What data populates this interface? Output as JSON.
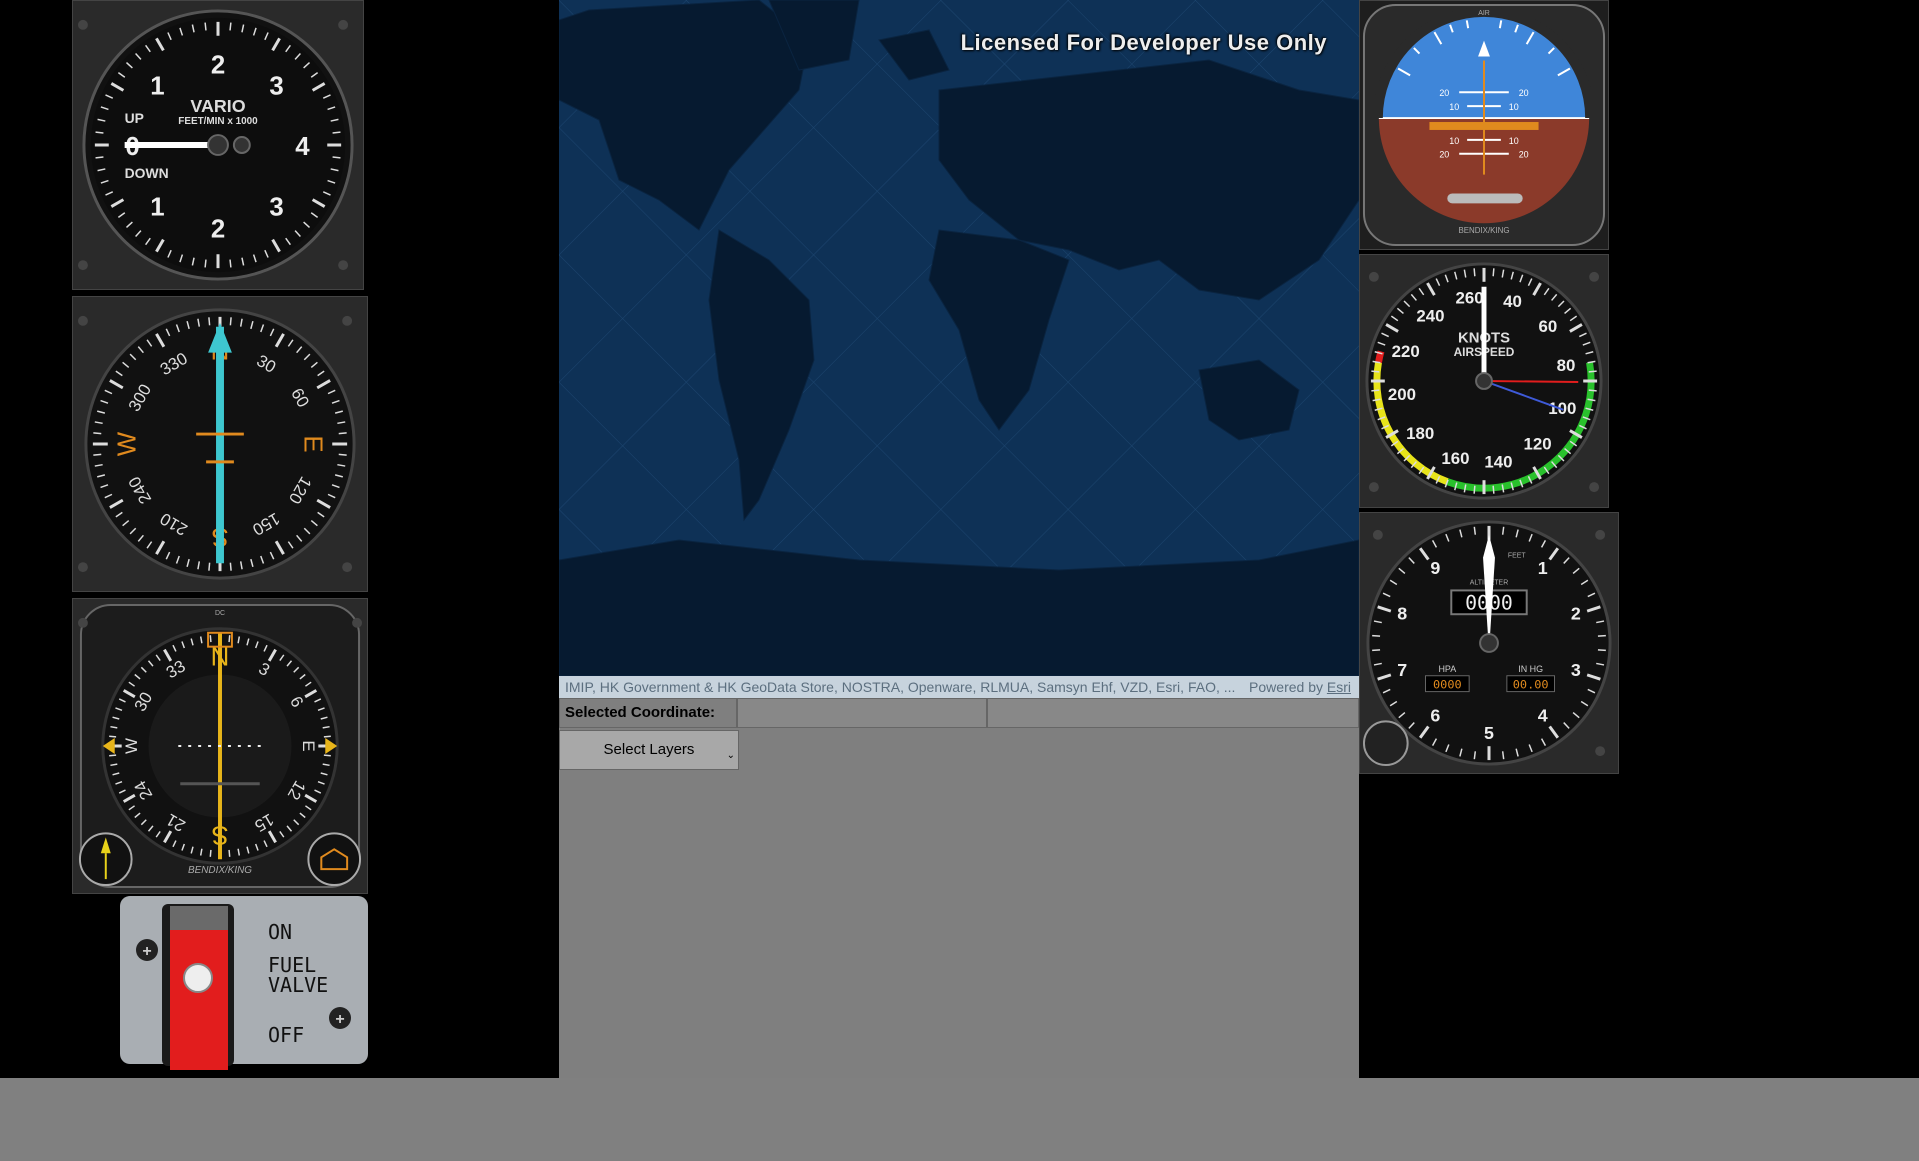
{
  "map": {
    "license_text": "Licensed For Developer Use Only",
    "attribution": "IMIP, HK Government & HK GeoData Store, NOSTRA, Openware, RLMUA, Samsyn Ehf, VZD, Esri, FAO, ...",
    "powered_by": "Powered by",
    "powered_link": "Esri",
    "selected_coordinate_label": "Selected Coordinate:",
    "select_layers_label": "Select Layers"
  },
  "gauges": {
    "vario": {
      "title": "VARIO",
      "subtitle": "FEET/MIN x 1000",
      "up": "UP",
      "down": "DOWN",
      "numbers": [
        "2",
        "3",
        "4",
        "3",
        "2",
        "1",
        "0",
        "1"
      ]
    },
    "heading": {
      "labels": [
        "N",
        "30",
        "60",
        "E",
        "120",
        "150",
        "S",
        "210",
        "240",
        "W",
        "300",
        "330"
      ]
    },
    "hsi": {
      "top_label": "DC",
      "brand": "BENDIX/KING",
      "labels": [
        "N",
        "3",
        "6",
        "E",
        "12",
        "15",
        "S",
        "21",
        "24",
        "W",
        "30",
        "33"
      ]
    },
    "attitude": {
      "top_label": "AIR",
      "brand": "BENDIX/KING",
      "pitch_labels": [
        "20",
        "10",
        "10",
        "20"
      ]
    },
    "airspeed": {
      "title": "KNOTS",
      "subtitle": "AIRSPEED",
      "numbers": [
        "40",
        "60",
        "80",
        "100",
        "120",
        "140",
        "160",
        "180",
        "200",
        "220",
        "240",
        "260"
      ]
    },
    "altimeter": {
      "title": "ALTIMETER",
      "feet": "FEET",
      "readout": "0000",
      "hpa_label": "HPA",
      "hpa_value": "0000",
      "inhg_label": "IN HG",
      "inhg_value": "00.00",
      "numbers": [
        "1",
        "2",
        "3",
        "4",
        "5",
        "6",
        "7",
        "8",
        "9"
      ]
    }
  },
  "fuel": {
    "on": "ON",
    "label_line1": "FUEL",
    "label_line2": "VALVE",
    "off": "OFF"
  },
  "colors": {
    "gauge_orange": "#e08a1e",
    "gauge_cyan": "#3ec7d0",
    "sky": "#3f86d9",
    "ground": "#8b3a2a",
    "switch_red": "#e21d1d",
    "map_water": "#0d2a48"
  }
}
